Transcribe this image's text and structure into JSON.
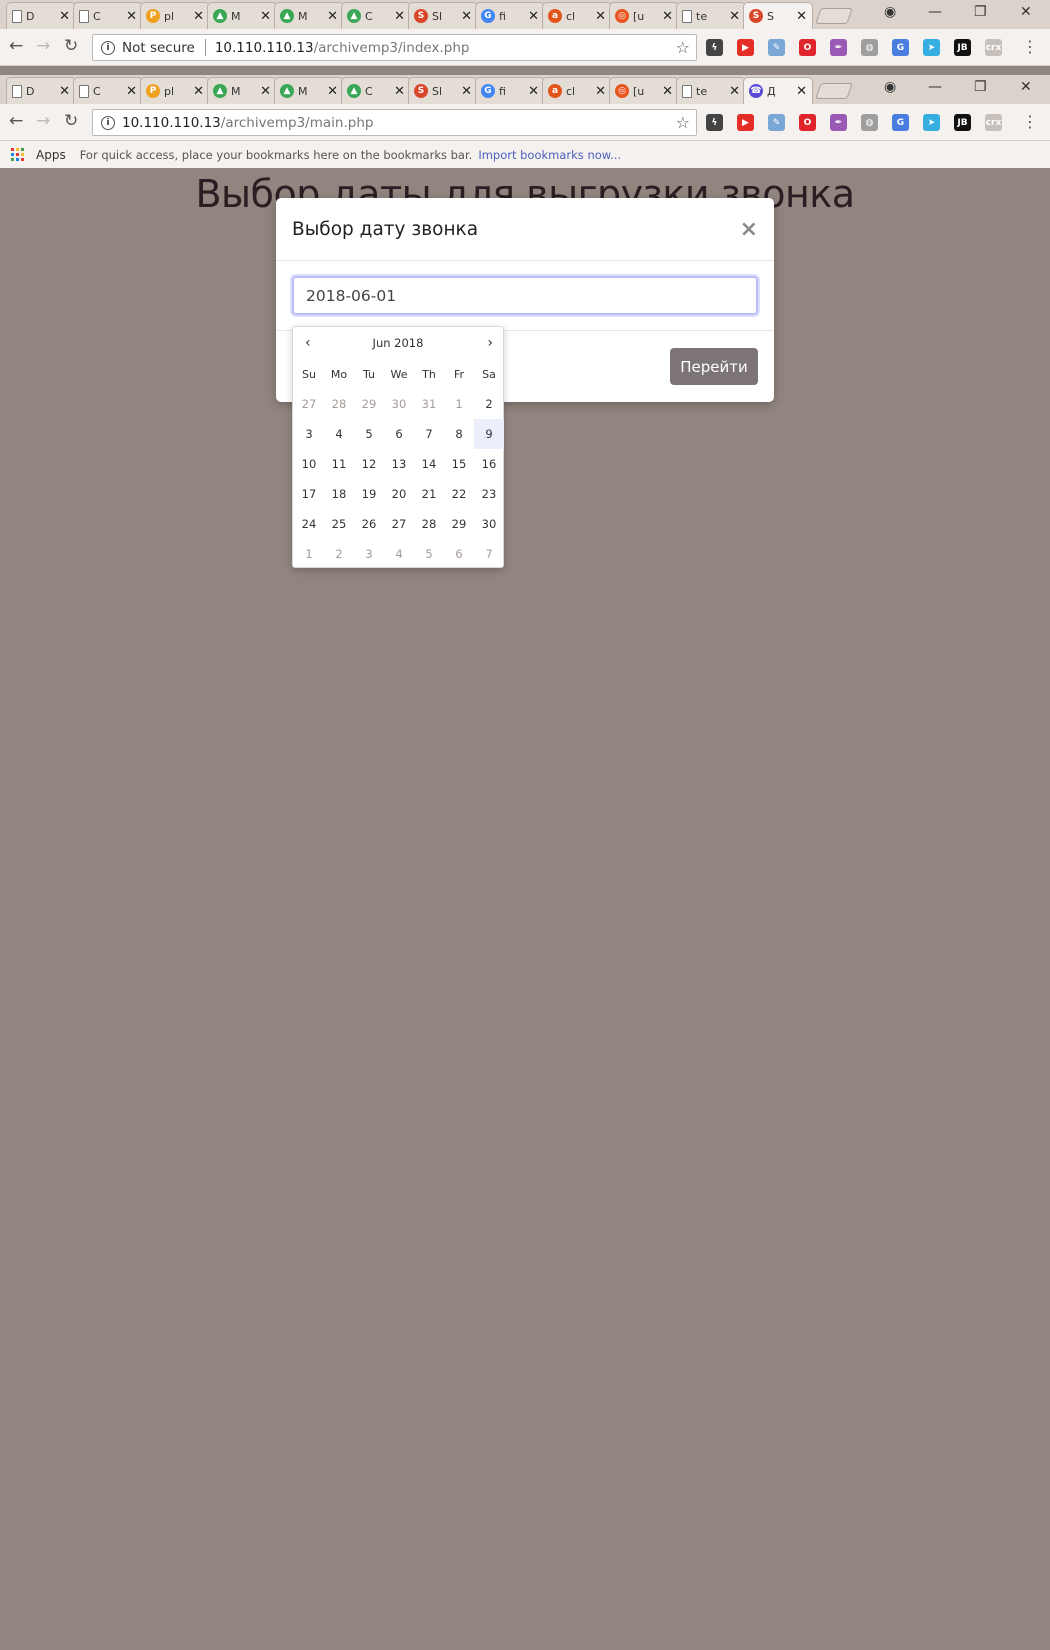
{
  "browser_top": {
    "tabs": [
      {
        "label": "D",
        "favicon": "page-icon"
      },
      {
        "label": "C",
        "favicon": "page-icon"
      },
      {
        "label": "pl",
        "favicon": "phpmyadmin-icon"
      },
      {
        "label": "M",
        "favicon": "drive-icon"
      },
      {
        "label": "M",
        "favicon": "drive-icon"
      },
      {
        "label": "C",
        "favicon": "drive-icon"
      },
      {
        "label": "Sl",
        "favicon": "s-logo-icon"
      },
      {
        "label": "fi",
        "favicon": "google-icon"
      },
      {
        "label": "cl",
        "favicon": "ask-icon"
      },
      {
        "label": "[u",
        "favicon": "ubuntu-icon"
      },
      {
        "label": "te",
        "favicon": "page-icon"
      },
      {
        "label": "S",
        "favicon": "s-logo-icon"
      }
    ],
    "omnibox": {
      "not_secure": "Not secure",
      "host": "10.110.110.13",
      "path": "/archivemp3/index.php"
    }
  },
  "browser_second": {
    "tabs": [
      {
        "label": "D",
        "favicon": "page-icon"
      },
      {
        "label": "C",
        "favicon": "page-icon"
      },
      {
        "label": "pl",
        "favicon": "phpmyadmin-icon"
      },
      {
        "label": "M",
        "favicon": "drive-icon"
      },
      {
        "label": "M",
        "favicon": "drive-icon"
      },
      {
        "label": "C",
        "favicon": "drive-icon"
      },
      {
        "label": "Sl",
        "favicon": "s-logo-icon"
      },
      {
        "label": "fi",
        "favicon": "google-icon"
      },
      {
        "label": "cl",
        "favicon": "ask-icon"
      },
      {
        "label": "[u",
        "favicon": "ubuntu-icon"
      },
      {
        "label": "te",
        "favicon": "page-icon"
      },
      {
        "label": "Д",
        "favicon": "phone-icon"
      }
    ],
    "omnibox": {
      "host": "10.110.110.13",
      "path": "/archivemp3/main.php"
    }
  },
  "bookmarks": {
    "apps": "Apps",
    "hint": "For quick access, place your bookmarks here on the bookmarks bar.",
    "import_link": "Import bookmarks now..."
  },
  "page": {
    "heading": "Выбор даты для выгрузки звонка"
  },
  "modal": {
    "title": "Выбор дату звонка",
    "close_glyph": "×",
    "date_value": "2018-06-01",
    "go_button": "Перейти"
  },
  "datepicker": {
    "month_label": "Jun 2018",
    "prev": "‹",
    "next": "›",
    "weekdays": [
      "Su",
      "Mo",
      "Tu",
      "We",
      "Th",
      "Fr",
      "Sa"
    ],
    "weeks": [
      [
        "27",
        "28",
        "29",
        "30",
        "31",
        "1",
        "2"
      ],
      [
        "3",
        "4",
        "5",
        "6",
        "7",
        "8",
        "9"
      ],
      [
        "10",
        "11",
        "12",
        "13",
        "14",
        "15",
        "16"
      ],
      [
        "17",
        "18",
        "19",
        "20",
        "21",
        "22",
        "23"
      ],
      [
        "24",
        "25",
        "26",
        "27",
        "28",
        "29",
        "30"
      ],
      [
        "1",
        "2",
        "3",
        "4",
        "5",
        "6",
        "7"
      ]
    ],
    "today": "9"
  },
  "colors": {
    "overlay": "#91857f",
    "go_button": "#7d7475",
    "input_focus": "#bcbcf7",
    "muted_day": "#a49b98"
  }
}
